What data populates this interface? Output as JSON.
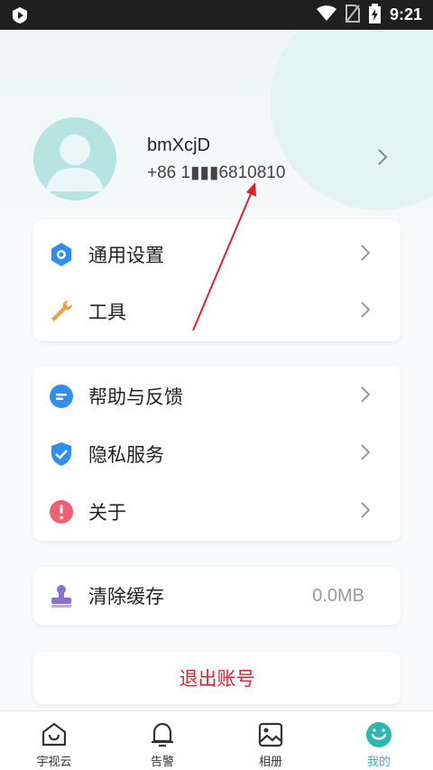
{
  "status_bar": {
    "time": "9:21",
    "icons": [
      "app-badge-icon",
      "wifi-icon",
      "no-sim-icon",
      "battery-charging-icon"
    ]
  },
  "profile": {
    "username": "bmXcjD",
    "phone": "+86 1▮▮▮6810810"
  },
  "menu_group_1": [
    {
      "label": "通用设置",
      "icon": "settings-hex-icon",
      "color": "#2f8ff0"
    },
    {
      "label": "工具",
      "icon": "wrench-icon",
      "color": "#f0a040"
    }
  ],
  "menu_group_2": [
    {
      "label": "帮助与反馈",
      "icon": "help-chat-icon",
      "color": "#2f8ff0"
    },
    {
      "label": "隐私服务",
      "icon": "shield-check-icon",
      "color": "#2f8ff0"
    },
    {
      "label": "关于",
      "icon": "info-icon",
      "color": "#f06070"
    }
  ],
  "cache": {
    "label": "清除缓存",
    "value": "0.0MB",
    "icon": "clean-stamp-icon",
    "color": "#8a6fd8"
  },
  "logout": {
    "label": "退出账号",
    "color": "#e0212c"
  },
  "tabs": [
    {
      "label": "宇视云",
      "icon": "home-icon",
      "active": false
    },
    {
      "label": "告警",
      "icon": "bell-icon",
      "active": false
    },
    {
      "label": "相册",
      "icon": "gallery-icon",
      "active": false
    },
    {
      "label": "我的",
      "icon": "profile-face-icon",
      "active": true
    }
  ],
  "colors": {
    "accent": "#2bb8b4",
    "danger": "#e0212c",
    "annotation": "#e0212c"
  }
}
